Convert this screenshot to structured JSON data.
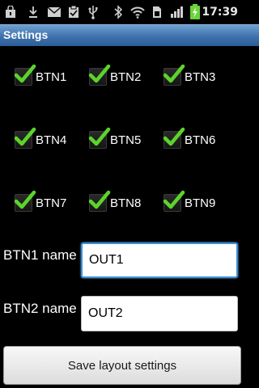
{
  "status_bar": {
    "time": "17:39",
    "icons": [
      "bag-icon",
      "download-icon",
      "mail-icon",
      "clipboard-icon",
      "usb-icon",
      "bluetooth-icon",
      "wifi-icon",
      "sim-icon",
      "signal-icon",
      "battery-charging-icon"
    ]
  },
  "title_bar": {
    "title": "Settings"
  },
  "checkboxes": [
    {
      "label": "BTN1",
      "checked": true
    },
    {
      "label": "BTN2",
      "checked": true
    },
    {
      "label": "BTN3",
      "checked": true
    },
    {
      "label": "BTN4",
      "checked": true
    },
    {
      "label": "BTN5",
      "checked": true
    },
    {
      "label": "BTN6",
      "checked": true
    },
    {
      "label": "BTN7",
      "checked": true
    },
    {
      "label": "BTN8",
      "checked": true
    },
    {
      "label": "BTN9",
      "checked": true
    }
  ],
  "fields": {
    "btn1": {
      "label": "BTN1 name",
      "value": "OUT1"
    },
    "btn2": {
      "label": "BTN2 name",
      "value": "OUT2"
    }
  },
  "save_button": {
    "label": "Save layout settings"
  },
  "colors": {
    "title_bar": "#3f72ad",
    "check_green": "#5bd42a",
    "focus_border": "#3d8fd6"
  }
}
